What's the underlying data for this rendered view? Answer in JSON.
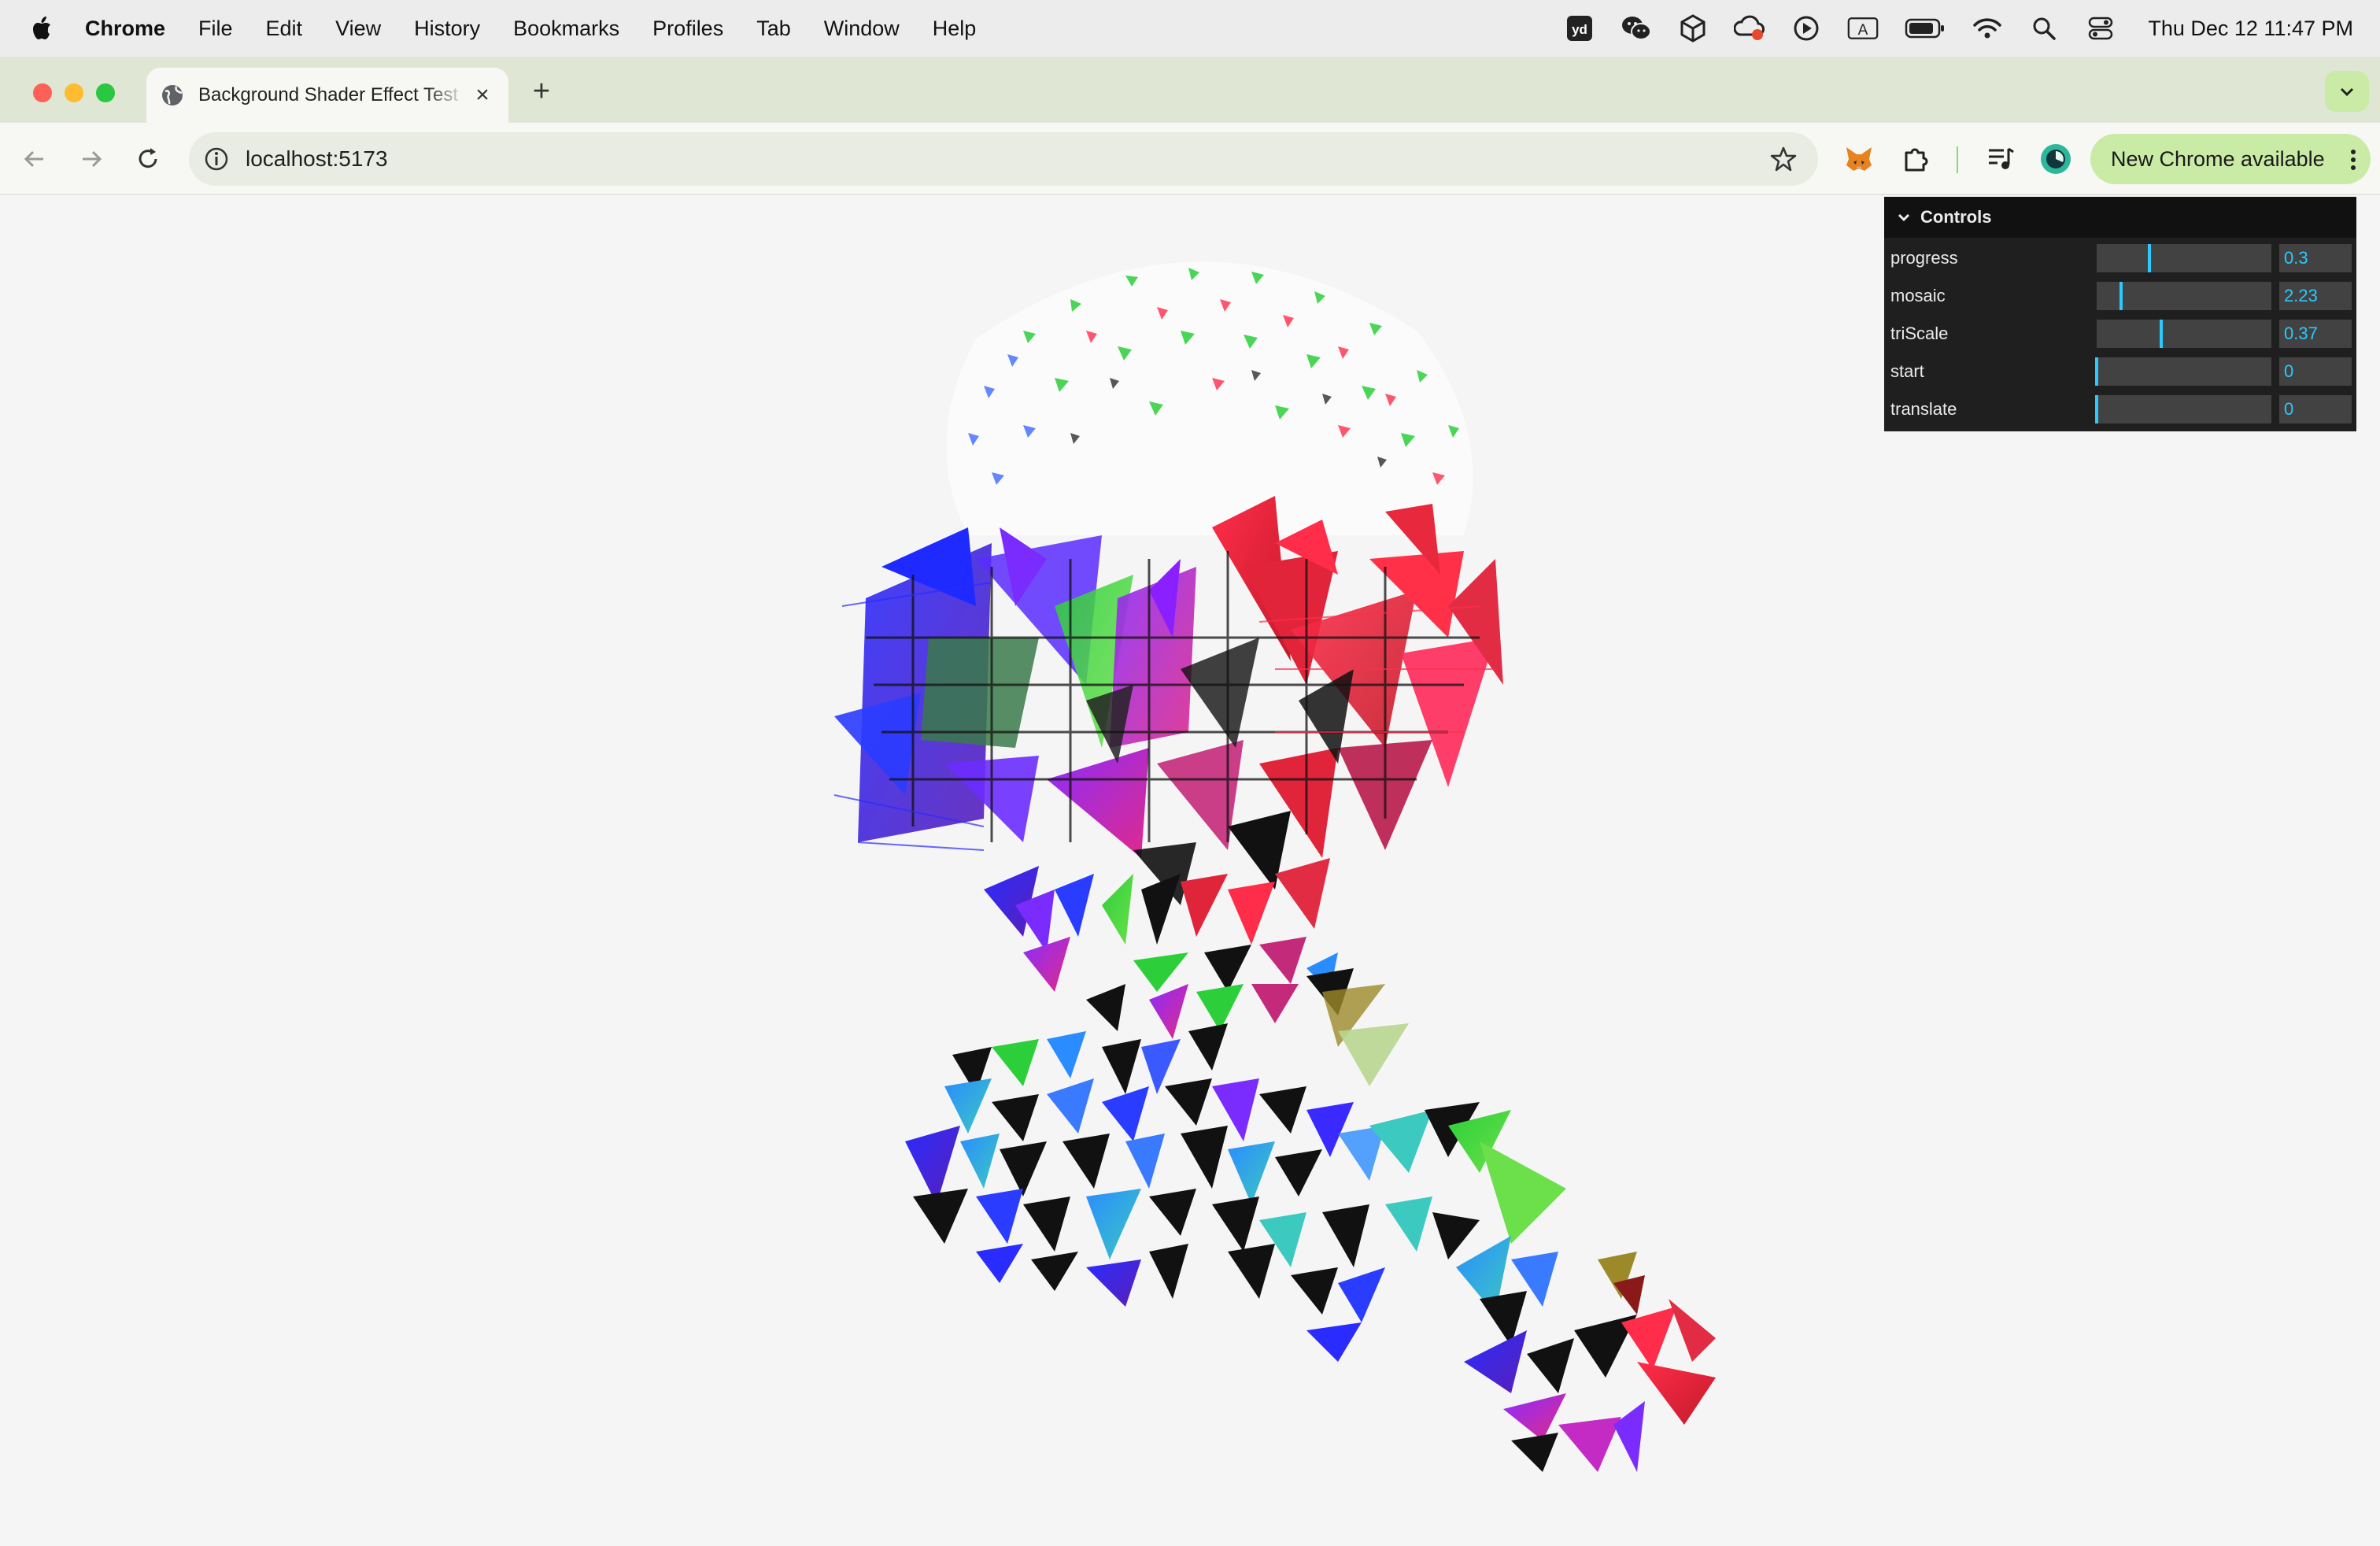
{
  "menubar": {
    "app_name": "Chrome",
    "items": [
      "File",
      "Edit",
      "View",
      "History",
      "Bookmarks",
      "Profiles",
      "Tab",
      "Window",
      "Help"
    ],
    "clock": "Thu Dec 12  11:47 PM"
  },
  "tab": {
    "title": "Background Shader Effect Test"
  },
  "toolbar": {
    "url": "localhost:5173",
    "update_label": "New Chrome available"
  },
  "gui": {
    "title": "Controls",
    "controls": [
      {
        "label": "progress",
        "value": "0.3",
        "fraction": 0.3
      },
      {
        "label": "mosaic",
        "value": "2.23",
        "fraction": 0.14
      },
      {
        "label": "triScale",
        "value": "0.37",
        "fraction": 0.37
      },
      {
        "label": "start",
        "value": "0",
        "fraction": 0
      },
      {
        "label": "translate",
        "value": "0",
        "fraction": 0
      }
    ]
  },
  "colors": {
    "menubar_bg": "#ececec",
    "tabstrip_bg": "#dfe7d4",
    "toolbar_bg": "#f7f8f3",
    "update_pill": "#c9eba6",
    "page_bg": "#f5f5f5",
    "gui_bg": "#1f1f1f",
    "gui_accent": "#2cc9ff"
  }
}
